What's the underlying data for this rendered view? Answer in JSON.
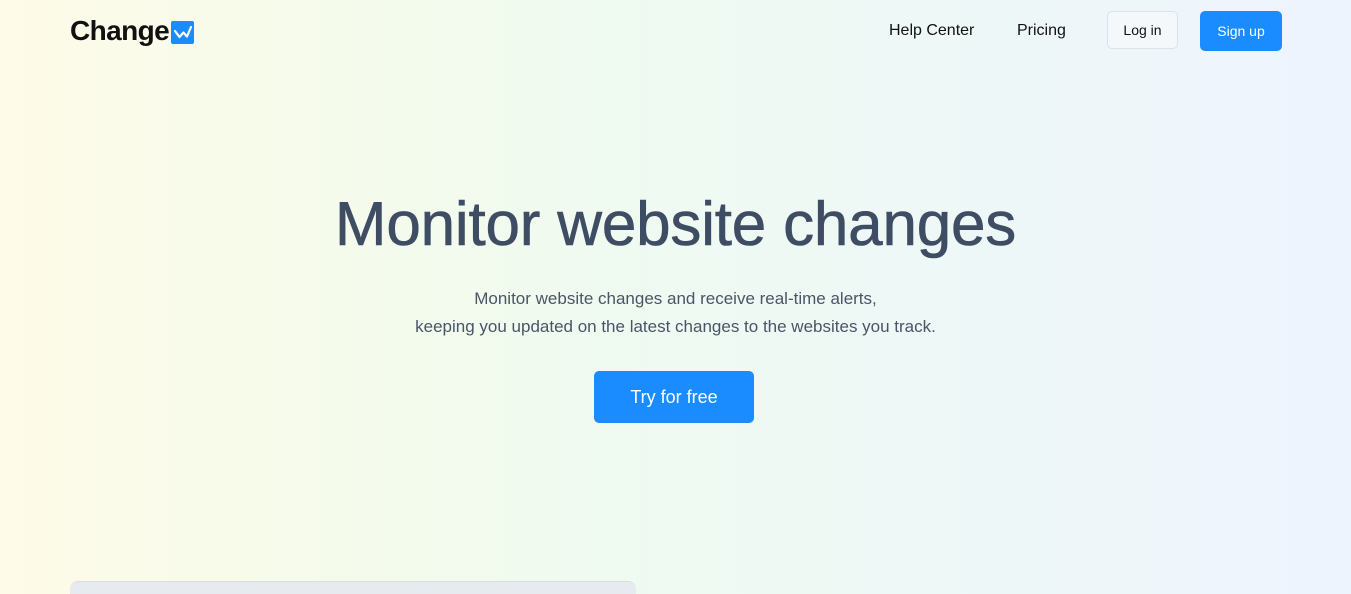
{
  "header": {
    "logo_text": "Change",
    "logo_icon": "chart-trend-icon",
    "nav": {
      "help_center": "Help Center",
      "pricing": "Pricing"
    },
    "login_label": "Log in",
    "signup_label": "Sign up"
  },
  "hero": {
    "title": "Monitor website changes",
    "subtitle_line1": "Monitor website changes and receive real-time alerts,",
    "subtitle_line2": "keeping you updated on the latest changes to the websites you track.",
    "cta_label": "Try for free"
  },
  "colors": {
    "accent": "#1a8cff",
    "title": "#3e4d63",
    "body_text": "#4a5567"
  }
}
